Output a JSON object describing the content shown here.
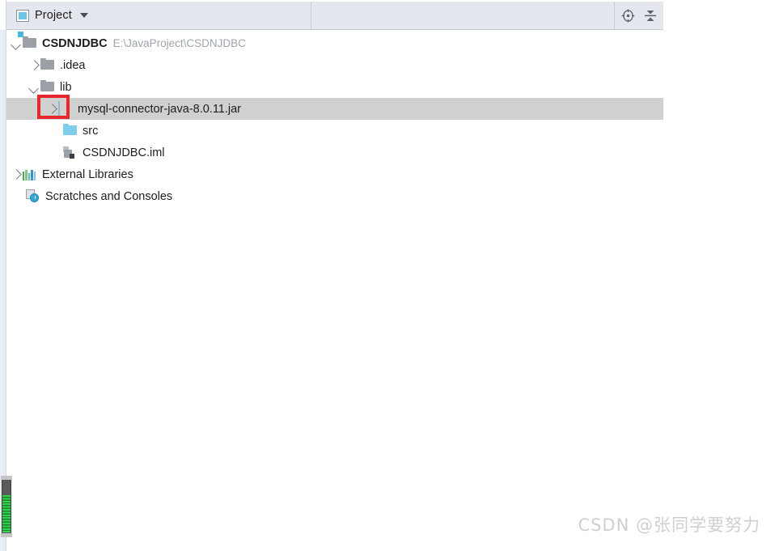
{
  "toolbar": {
    "title": "Project",
    "project_icon": "project-icon",
    "dropdown_icon": "chevron-down-icon",
    "buttons": [
      {
        "name": "locate-button",
        "icon": "crosshair-target-icon"
      },
      {
        "name": "collapse-all-button",
        "icon": "collapse-all-icon"
      }
    ]
  },
  "tree": {
    "nodes": [
      {
        "label": "CSDNJDBC",
        "path": "E:\\JavaProject\\CSDNJDBC",
        "icon": "project-folder-icon",
        "arrow": "expanded",
        "indent": 0,
        "bold": true,
        "selected": false
      },
      {
        "label": ".idea",
        "path": "",
        "icon": "folder-gray-icon",
        "arrow": "collapsed",
        "indent": 1,
        "bold": false,
        "selected": false
      },
      {
        "label": "lib",
        "path": "",
        "icon": "folder-gray-icon",
        "arrow": "expanded",
        "indent": 1,
        "bold": false,
        "selected": false
      },
      {
        "label": "mysql-connector-java-8.0.11.jar",
        "path": "",
        "icon": "jar-archive-icon",
        "arrow": "collapsed",
        "indent": 2,
        "bold": false,
        "selected": true
      },
      {
        "label": "src",
        "path": "",
        "icon": "folder-blue-source-icon",
        "arrow": "none",
        "indent": 2,
        "bold": false,
        "selected": false
      },
      {
        "label": "CSDNJDBC.iml",
        "path": "",
        "icon": "module-iml-icon",
        "arrow": "none",
        "indent": 2,
        "bold": false,
        "selected": false
      },
      {
        "label": "External Libraries",
        "path": "",
        "icon": "library-bars-icon",
        "arrow": "collapsed",
        "indent": 0,
        "bold": false,
        "selected": false
      },
      {
        "label": "Scratches and Consoles",
        "path": "",
        "icon": "scratches-clock-icon",
        "arrow": "none",
        "indent": 0,
        "bold": false,
        "selected": false
      }
    ]
  },
  "annotation": {
    "highlight_box_color": "#e8262b",
    "target": "expand-arrow-of-jar-node"
  },
  "scrollbar": {
    "name": "vertical-scroll-indicator",
    "track_color": "#5a5a5a",
    "fill_color": "#2fd84a"
  },
  "watermark": {
    "text": "CSDN @张同学要努力"
  },
  "colors": {
    "toolbar_bg": "#e4e7ed",
    "selection_bg": "#d0d0d0",
    "path_text": "#9ea4ac",
    "label_text": "#1d1d1d"
  }
}
